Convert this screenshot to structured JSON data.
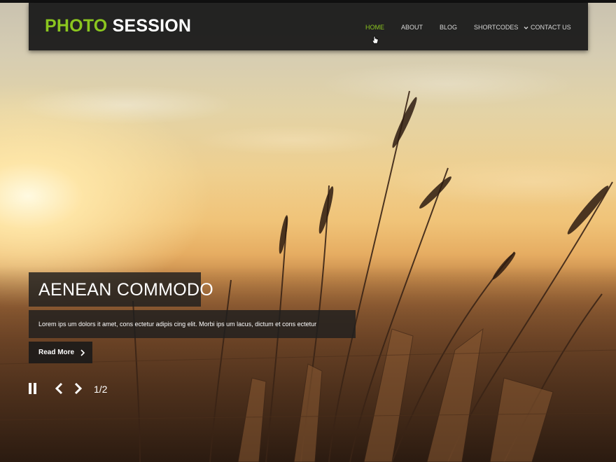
{
  "site": {
    "logo_word1": "PHOTO",
    "logo_word2": "SESSION",
    "accent_color": "#8bc61f"
  },
  "nav": {
    "items": [
      {
        "label": "HOME",
        "active": true
      },
      {
        "label": "ABOUT",
        "active": false
      },
      {
        "label": "BLOG",
        "active": false
      },
      {
        "label": "SHORTCODES",
        "active": false,
        "has_dropdown": true
      },
      {
        "label": "CONTACT US",
        "active": false
      }
    ]
  },
  "slide": {
    "title": "AENEAN COMMODO",
    "text": "Lorem ips um dolors it amet, cons ectetur adipis cing elit. Morbi ips um lacus, dictum et cons ectetur",
    "button_label": "Read More",
    "counter": "1/2"
  },
  "icons": {
    "pause": "pause-icon",
    "prev": "chevron-left-icon",
    "next": "chevron-right-icon",
    "dropdown": "chevron-down-icon",
    "cursor": "hand-pointer-icon"
  }
}
